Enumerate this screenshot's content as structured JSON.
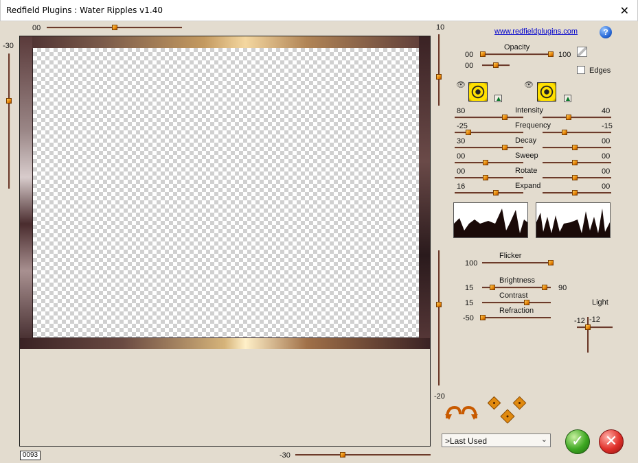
{
  "window": {
    "title": "Redfield Plugins : Water Ripples v1.40",
    "close_glyph": "✕"
  },
  "top_slider": {
    "value": "00"
  },
  "left_slider": {
    "value": "-30"
  },
  "right_vslider": {
    "top_value": "10",
    "bottom_value": "-20"
  },
  "bottom_slider": {
    "value": "-30"
  },
  "frame_counter": "0093",
  "link_text": "www.redfieldplugins.com",
  "help_label": "?",
  "opacity": {
    "label": "Opacity",
    "min": "00",
    "max": "100",
    "second_value": "00"
  },
  "edges": {
    "label": "Edges",
    "checked": false
  },
  "params": [
    {
      "label": "Intensity",
      "left": "80",
      "right": "40",
      "left_level": 0.73,
      "right_level": 0.38
    },
    {
      "label": "Frequency",
      "left": "-25",
      "right": "-15",
      "left_level": 0.2,
      "right_level": 0.32
    },
    {
      "label": "Decay",
      "left": "30",
      "right": "00",
      "left_level": 0.73,
      "right_level": 0.47
    },
    {
      "label": "Sweep",
      "left": "00",
      "right": "00",
      "left_level": 0.45,
      "right_level": 0.47
    },
    {
      "label": "Rotate",
      "left": "00",
      "right": "00",
      "left_level": 0.45,
      "right_level": 0.47
    },
    {
      "label": "Expand",
      "left": "16",
      "right": "00",
      "left_level": 0.6,
      "right_level": 0.47
    }
  ],
  "flicker": {
    "label": "Flicker",
    "value": "100"
  },
  "brightness": {
    "label": "Brightness",
    "min": "15",
    "max": "90"
  },
  "contrast": {
    "label": "Contrast",
    "value": "15"
  },
  "refraction": {
    "label": "Refraction",
    "value": "-50"
  },
  "light": {
    "label": "Light",
    "x": "-12",
    "y": "-12"
  },
  "preset": {
    "value": ">Last Used"
  },
  "icons": {
    "eye": "👁",
    "ok": "✓",
    "cancel": "✕",
    "dropdown_arrow": "⌄"
  }
}
